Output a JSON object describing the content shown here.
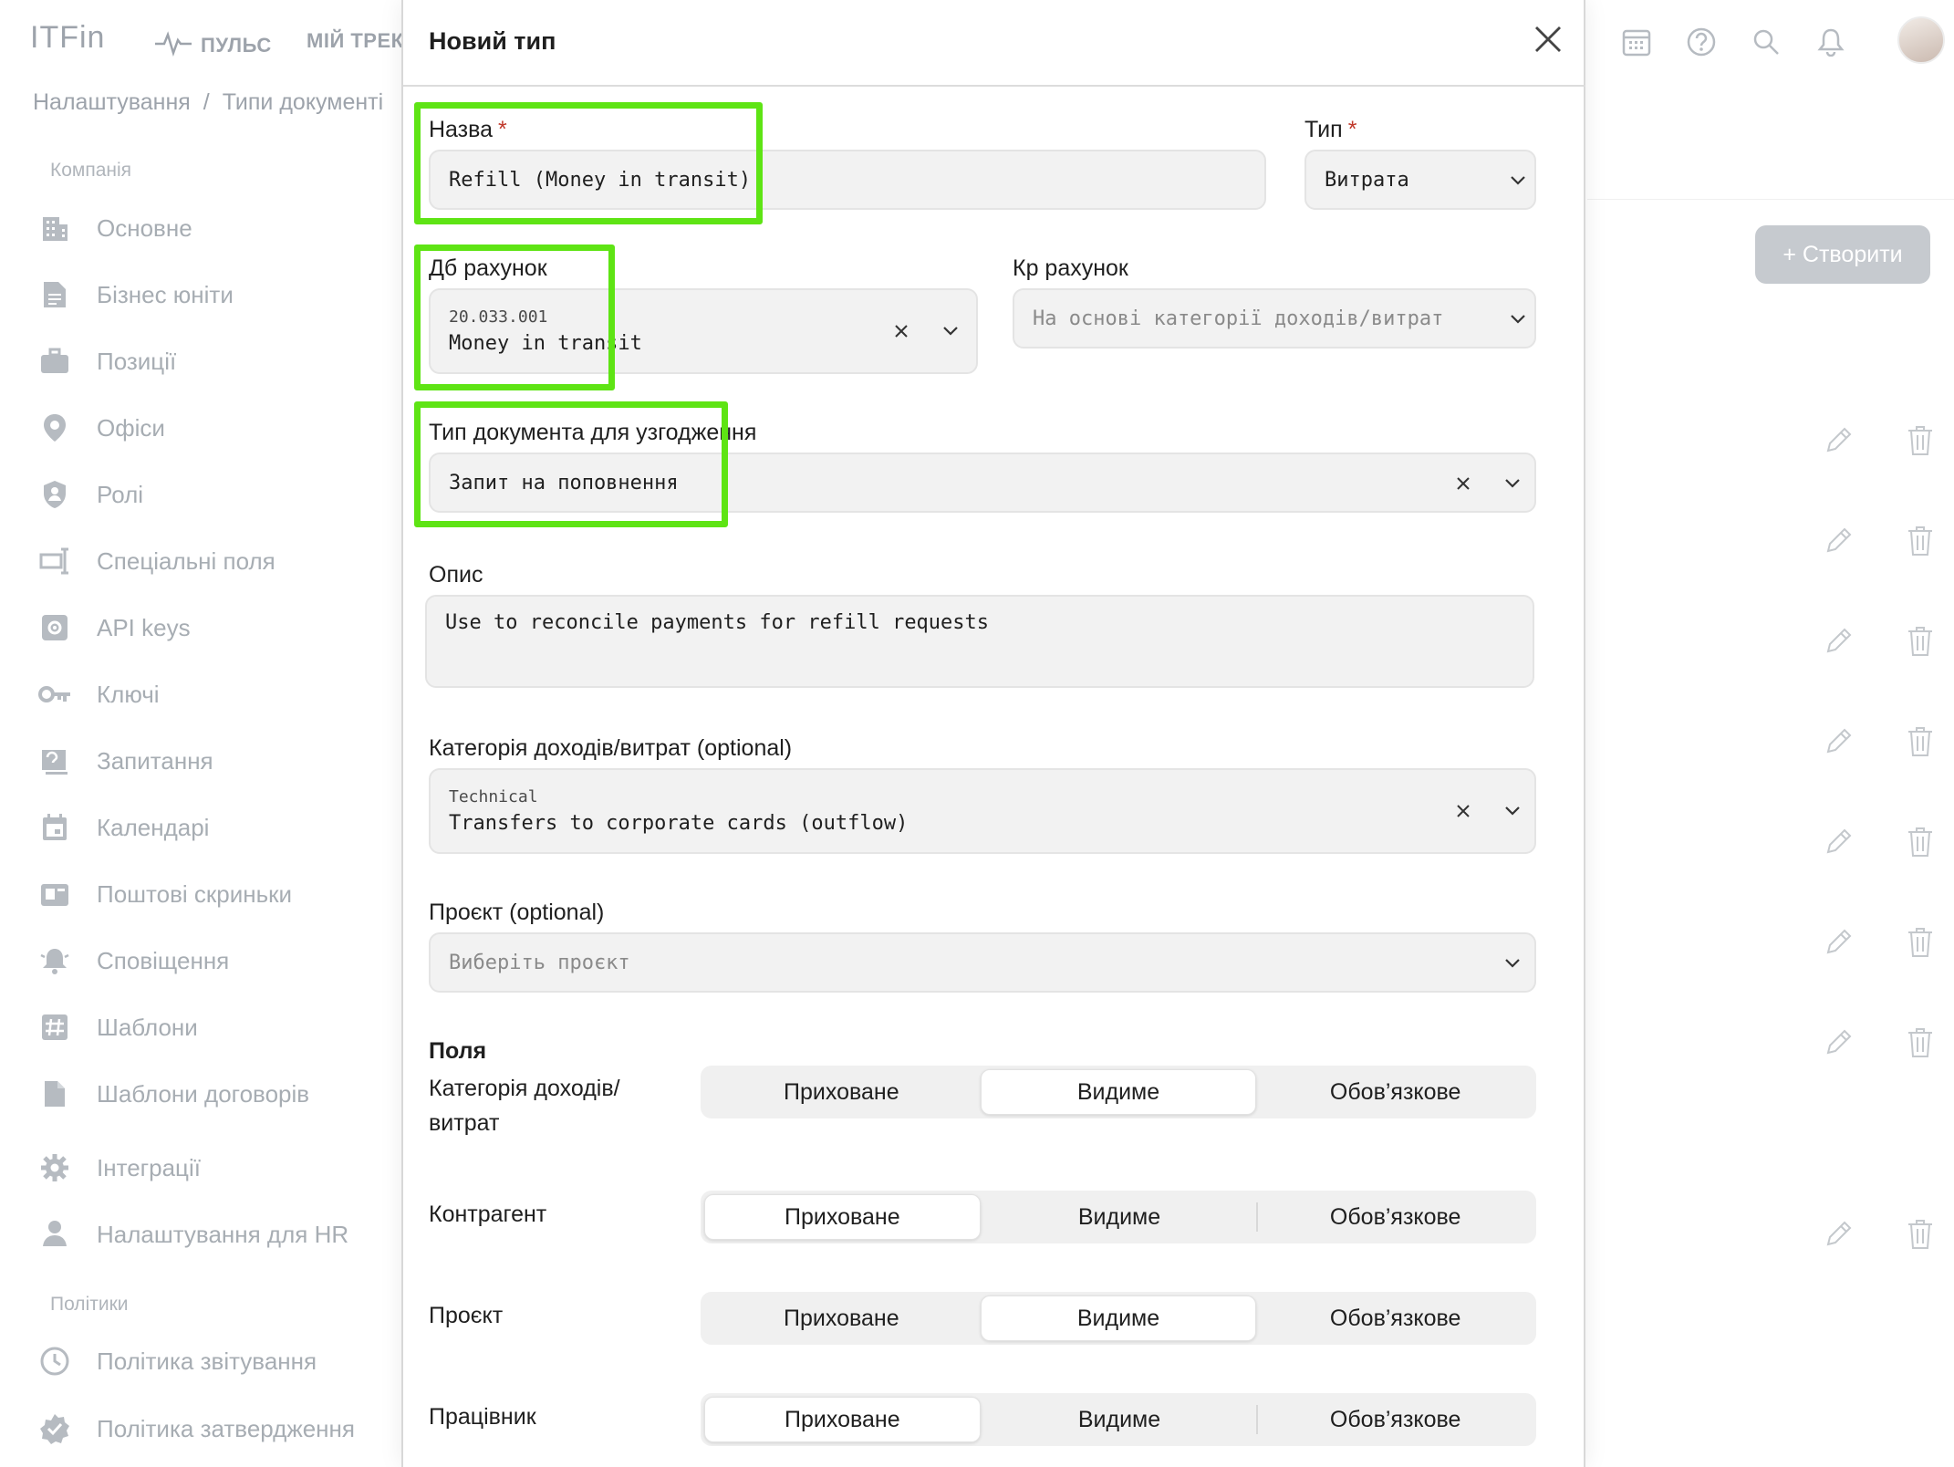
{
  "app": {
    "logo": "ITFin",
    "nav": [
      {
        "label": "ПУЛЬС",
        "icon": "pulse-icon"
      },
      {
        "label": "МІЙ ТРЕКЕ"
      }
    ],
    "breadcrumb": {
      "root": "Налаштування",
      "separator": "/",
      "current": "Типи документі"
    },
    "sidebar": {
      "sections": [
        {
          "title": "Компанія",
          "items": [
            {
              "label": "Основне",
              "icon": "building-icon"
            },
            {
              "label": "Бізнес юніти",
              "icon": "document-icon"
            },
            {
              "label": "Позиції",
              "icon": "briefcase-icon"
            },
            {
              "label": "Офіси",
              "icon": "location-pin-icon"
            },
            {
              "label": "Ролі",
              "icon": "shield-user-icon"
            },
            {
              "label": "Спеціальні поля",
              "icon": "custom-field-icon"
            },
            {
              "label": "API keys",
              "icon": "api-key-icon"
            },
            {
              "label": "Ключі",
              "icon": "key-icon"
            },
            {
              "label": "Запитання",
              "icon": "question-board-icon"
            },
            {
              "label": "Календарі",
              "icon": "calendar-icon"
            },
            {
              "label": "Поштові скриньки",
              "icon": "mailbox-icon"
            },
            {
              "label": "Сповіщення",
              "icon": "bell-icon"
            },
            {
              "label": "Шаблони",
              "icon": "hash-icon"
            },
            {
              "label": "Шаблони договорів",
              "icon": "file-icon"
            },
            {
              "label": "Інтеграції",
              "icon": "gear-icon"
            },
            {
              "label": "Налаштування для HR",
              "icon": "person-icon"
            }
          ]
        },
        {
          "title": "Політики",
          "items": [
            {
              "label": "Політика звітування",
              "icon": "clock-icon"
            },
            {
              "label": "Політика затвердження",
              "icon": "badge-check-icon"
            }
          ]
        }
      ]
    },
    "toolbar_icons": [
      "calendar-grid-icon",
      "help-icon",
      "search-icon",
      "bell-icon"
    ],
    "create_button": "+ Створити"
  },
  "modal": {
    "title": "Новий тип",
    "name": {
      "label": "Назва",
      "required_mark": "*",
      "value": "Refill (Money in transit)"
    },
    "type": {
      "label": "Тип",
      "required_mark": "*",
      "value": "Витрата"
    },
    "debit_account": {
      "label": "Дб рахунок",
      "code": "20.033.001",
      "name": "Money in transit"
    },
    "credit_account": {
      "label": "Кр рахунок",
      "placeholder": "На основі категорії доходів/витрат"
    },
    "reconcile_doc_type": {
      "label": "Тип документа для узгодження",
      "value": "Запит на поповнення"
    },
    "description": {
      "label": "Опис",
      "value": "Use to reconcile payments for refill requests"
    },
    "category": {
      "label": "Категорія доходів/витрат (optional)",
      "group": "Technical",
      "value": "Transfers to corporate cards (outflow)"
    },
    "project": {
      "label": "Проєкт (optional)",
      "placeholder": "Виберіть проєкт"
    },
    "fields": {
      "title": "Поля",
      "options": [
        "Приховане",
        "Видиме",
        "Обов’язкове"
      ],
      "rows": [
        {
          "label": "Категорія доходів/ витрат",
          "selected": "Видиме"
        },
        {
          "label": "Контрагент",
          "selected": "Приховане"
        },
        {
          "label": "Проєкт",
          "selected": "Видиме"
        },
        {
          "label": "Працівник",
          "selected": "Приховане"
        }
      ]
    }
  },
  "colors": {
    "highlight": "#5ee414",
    "required": "#c0392b",
    "muted": "#a7adb3"
  }
}
